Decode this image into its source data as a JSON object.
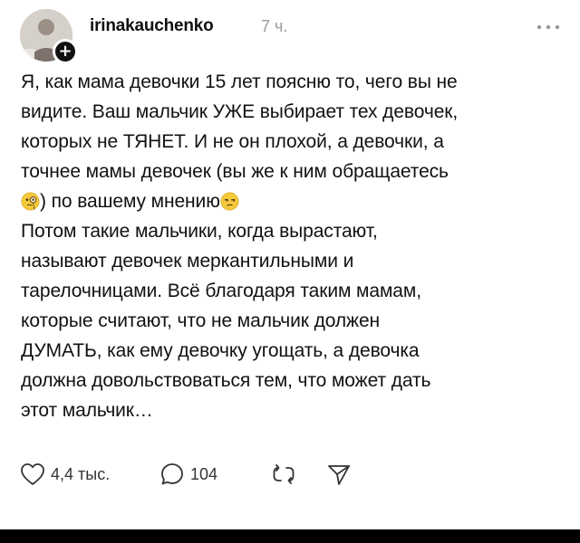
{
  "post": {
    "author": {
      "username": "irinakauchenko",
      "timestamp": "7 ч.",
      "follow_symbol": "+"
    },
    "paragraphs": [
      {
        "lines": [
          "Я, как мама девочки 15 лет поясню то, чего вы не",
          "видите. Ваш мальчик УЖЕ выбирает тех девочек,",
          "которых не ТЯНЕТ. И не он плохой, а девочки, а",
          "точнее мамы девочек (вы же к ним обращаетесь"
        ],
        "line5_part1": ") по вашему мнению"
      },
      {
        "lines": [
          "Потом такие мальчики, когда вырастают,",
          "называют девочек меркантильными и",
          "тарелочницами. Всё благодаря таким мамам,",
          "которые считают, что не мальчик должен",
          "ДУМАТЬ, как ему девочку угощать, а девочка",
          "должна довольствоваться тем, что может дать",
          "этот мальчик…"
        ]
      }
    ],
    "emojis": [
      "face-with-monocle-icon",
      "unamused-face-icon"
    ],
    "actions": {
      "likes": "4,4 тыс.",
      "comments": "104"
    }
  },
  "colors": {
    "text": "#111111",
    "muted": "#9a9a9a",
    "background": "#ffffff"
  }
}
